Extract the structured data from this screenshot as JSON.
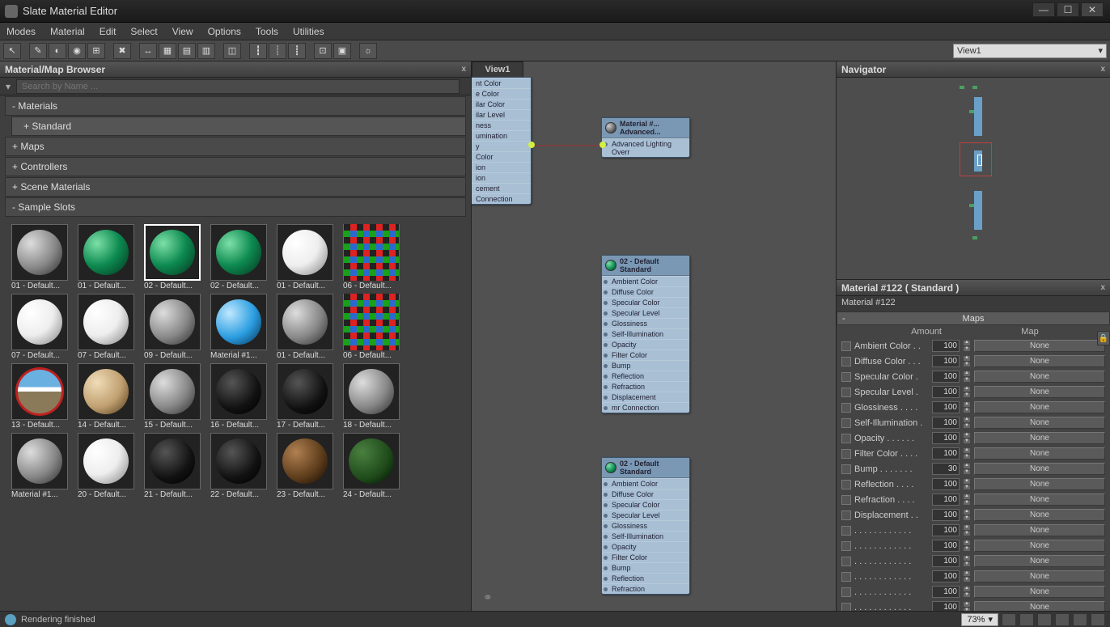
{
  "window": {
    "title": "Slate Material Editor"
  },
  "menu": [
    "Modes",
    "Material",
    "Edit",
    "Select",
    "View",
    "Options",
    "Tools",
    "Utilities"
  ],
  "toolbar_viewcombo": "View1",
  "browser": {
    "title": "Material/Map Browser",
    "search_placeholder": "Search by Name ...",
    "tree": [
      {
        "label": "- Materials"
      },
      {
        "label": "+ Standard",
        "sub": true
      },
      {
        "label": "+ Maps"
      },
      {
        "label": "+ Controllers"
      },
      {
        "label": "+ Scene Materials"
      },
      {
        "label": "- Sample Slots"
      }
    ],
    "slots": [
      {
        "label": "01 - Default...",
        "style": "grey"
      },
      {
        "label": "01 - Default...",
        "style": "green"
      },
      {
        "label": "02 - Default...",
        "style": "green",
        "selected": true
      },
      {
        "label": "02 - Default...",
        "style": "green"
      },
      {
        "label": "01 - Default...",
        "style": "white"
      },
      {
        "label": "06 - Default...",
        "style": "checker"
      },
      {
        "label": "07 - Default...",
        "style": "white"
      },
      {
        "label": "07 - Default...",
        "style": "white"
      },
      {
        "label": "09 - Default...",
        "style": "grey"
      },
      {
        "label": "Material #1...",
        "style": "blue"
      },
      {
        "label": "01 - Default...",
        "style": "grey"
      },
      {
        "label": "06 - Default...",
        "style": "checker"
      },
      {
        "label": "13 - Default...",
        "style": "hdr"
      },
      {
        "label": "14 - Default...",
        "style": "tan"
      },
      {
        "label": "15 - Default...",
        "style": "grey"
      },
      {
        "label": "16 - Default...",
        "style": "black"
      },
      {
        "label": "17 - Default...",
        "style": "black"
      },
      {
        "label": "18 - Default...",
        "style": "grey"
      },
      {
        "label": "Material #1...",
        "style": "grey"
      },
      {
        "label": "20 - Default...",
        "style": "white"
      },
      {
        "label": "21 - Default...",
        "style": "black"
      },
      {
        "label": "22 - Default...",
        "style": "black"
      },
      {
        "label": "23 - Default...",
        "style": "brown"
      },
      {
        "label": "24 - Default...",
        "style": "dgreen"
      }
    ]
  },
  "view": {
    "tab": "View1",
    "node_partial_rows": [
      "nt Color",
      "e Color",
      "ilar Color",
      "ilar Level",
      "ness",
      "umination",
      "y",
      "Color",
      "ion",
      "ion",
      "cement",
      "Connection"
    ],
    "node_adv": {
      "title1": "Material #...",
      "title2": "Advanced...",
      "row": "Advanced Lighting Overr"
    },
    "node_std": {
      "title1": "02 - Default",
      "title2": "Standard",
      "rows": [
        "Ambient Color",
        "Diffuse Color",
        "Specular Color",
        "Specular Level",
        "Glossiness",
        "Self-Illumination",
        "Opacity",
        "Filter Color",
        "Bump",
        "Reflection",
        "Refraction",
        "Displacement",
        "mr Connection"
      ]
    },
    "node_std2": {
      "title1": "02 - Default",
      "title2": "Standard",
      "rows": [
        "Ambient Color",
        "Diffuse Color",
        "Specular Color",
        "Specular Level",
        "Glossiness",
        "Self-Illumination",
        "Opacity",
        "Filter Color",
        "Bump",
        "Reflection",
        "Refraction"
      ]
    }
  },
  "navigator": {
    "title": "Navigator"
  },
  "params": {
    "header": "Material #122  ( Standard )",
    "name": "Material #122",
    "rollup": "Maps",
    "col_amount": "Amount",
    "col_map": "Map",
    "rows": [
      {
        "label": "Ambient Color . .",
        "amount": "100",
        "map": "None"
      },
      {
        "label": "Diffuse Color . . .",
        "amount": "100",
        "map": "None"
      },
      {
        "label": "Specular Color .",
        "amount": "100",
        "map": "None"
      },
      {
        "label": "Specular Level .",
        "amount": "100",
        "map": "None"
      },
      {
        "label": "Glossiness . . . .",
        "amount": "100",
        "map": "None"
      },
      {
        "label": "Self-Illumination .",
        "amount": "100",
        "map": "None"
      },
      {
        "label": "Opacity . . . . . .",
        "amount": "100",
        "map": "None"
      },
      {
        "label": "Filter Color . . . .",
        "amount": "100",
        "map": "None"
      },
      {
        "label": "Bump . . . . . . .",
        "amount": "30",
        "map": "None"
      },
      {
        "label": "Reflection . . . .",
        "amount": "100",
        "map": "None"
      },
      {
        "label": "Refraction . . . .",
        "amount": "100",
        "map": "None"
      },
      {
        "label": "Displacement . .",
        "amount": "100",
        "map": "None"
      },
      {
        "label": ". . . . . . . . . . . .",
        "amount": "100",
        "map": "None"
      },
      {
        "label": ". . . . . . . . . . . .",
        "amount": "100",
        "map": "None"
      },
      {
        "label": ". . . . . . . . . . . .",
        "amount": "100",
        "map": "None"
      },
      {
        "label": ". . . . . . . . . . . .",
        "amount": "100",
        "map": "None"
      },
      {
        "label": ". . . . . . . . . . . .",
        "amount": "100",
        "map": "None"
      },
      {
        "label": ". . . . . . . . . . . .",
        "amount": "100",
        "map": "None"
      }
    ]
  },
  "status": {
    "text": "Rendering finished",
    "zoom": "73%"
  }
}
